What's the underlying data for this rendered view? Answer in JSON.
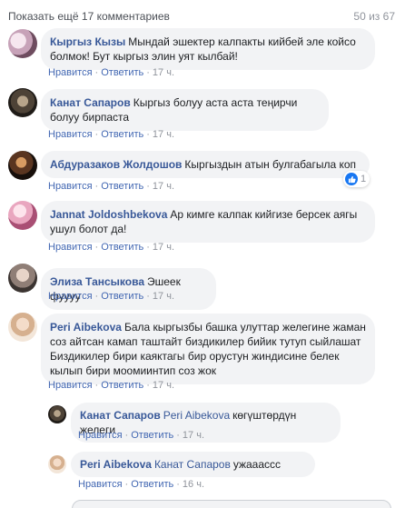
{
  "header": {
    "show_more": "Показать ещё 17 комментариев",
    "counter": "50 из 67"
  },
  "labels": {
    "like": "Нравится",
    "reply": "Ответить",
    "dot": "·"
  },
  "comments": [
    {
      "author": "Кыргыз Кызы",
      "text": "Мындай эшектер калпакты кийбей эле койсо болмок! Бут кыргыз элин уят кылбай!",
      "time": "17 ч."
    },
    {
      "author": "Канат Сапаров",
      "text": "Кыргыз болуу аста аста теңирчи болуу бирпаста",
      "time": "17 ч."
    },
    {
      "author": "Абдуразаков Жолдошов",
      "text": "Кыргыздын атын булгабагыла коп",
      "time": "17 ч.",
      "reactions": "1"
    },
    {
      "author": "Jannat Joldoshbekova",
      "text": "Ар кимге калпак кийгизе берсек аягы ушул болот да!",
      "time": "17 ч."
    },
    {
      "author": "Элиза Тансыкова",
      "text": "Эшеек фуууу",
      "time": "17 ч."
    },
    {
      "author": "Peri Aibekova",
      "text": "Бала кыргызбы башка улуттар желегине жаман соз айтсан камап таштайт биздикилер бийик тутуп сыйлашат Биздикилер бири каяктагы бир орустун жиндисине белек кылып бири моомиинтип соз жок",
      "time": "17 ч."
    }
  ],
  "replies": [
    {
      "author": "Канат Сапаров",
      "mention": "Peri Aibekova",
      "text": "көгүштөрдүн желеги",
      "time": "17 ч."
    },
    {
      "author": "Peri Aibekova",
      "mention": "Канат Сапаров",
      "text": "ужааассс",
      "time": "16 ч."
    }
  ],
  "colors": {
    "link": "#385898",
    "action": "#4267b2",
    "muted": "#90949c",
    "bubble": "#f2f3f5",
    "like": "#1877f2"
  }
}
